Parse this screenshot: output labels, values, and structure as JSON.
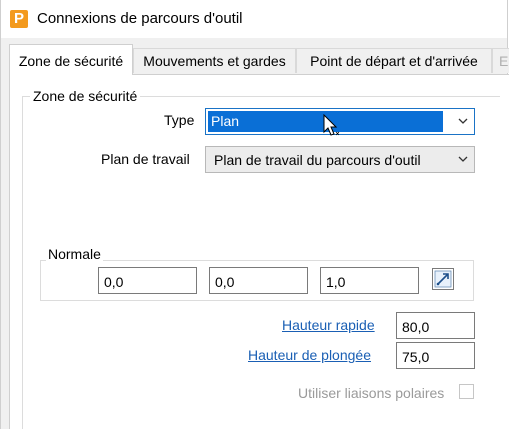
{
  "window": {
    "title": "Connexions de parcours d'outil"
  },
  "tabs": [
    {
      "label": "Zone de sécurité",
      "active": true
    },
    {
      "label": "Mouvements et gardes"
    },
    {
      "label": "Point de départ et d'arrivée"
    },
    {
      "label": "E",
      "disabled": true
    }
  ],
  "group": {
    "label": "Zone de sécurité",
    "type_label": "Type",
    "type_value": "Plan",
    "workplane_label": "Plan de travail",
    "workplane_value": "Plan de travail du parcours d'outil"
  },
  "normal": {
    "label": "Normale",
    "x": "0,0",
    "y": "0,0",
    "z": "1,0"
  },
  "heights": {
    "rapid_label": "Hauteur rapide",
    "rapid_value": "80,0",
    "plunge_label": "Hauteur de plongée",
    "plunge_value": "75,0"
  },
  "polar": {
    "label": "Utiliser liaisons polaires",
    "checked": false
  },
  "colors": {
    "accent": "#0a6fd6",
    "link": "#1a5fb4",
    "app_icon": "#f39a1e"
  }
}
